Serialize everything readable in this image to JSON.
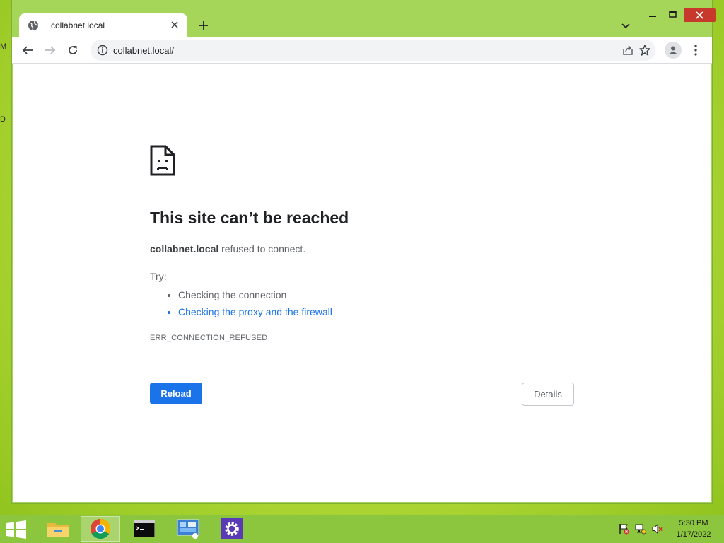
{
  "desktop": {
    "edge_marks": [
      "M",
      "D"
    ]
  },
  "browser": {
    "tab": {
      "title": "collabnet.local"
    },
    "address_bar": {
      "url": "collabnet.local/"
    }
  },
  "error_page": {
    "heading": "This site can’t be reached",
    "host": "collabnet.local",
    "summary_rest": " refused to connect.",
    "try_label": "Try:",
    "suggestions": [
      {
        "text": "Checking the connection",
        "is_link": false
      },
      {
        "text": "Checking the proxy and the firewall",
        "is_link": true
      }
    ],
    "error_code": "ERR_CONNECTION_REFUSED",
    "reload_label": "Reload",
    "details_label": "Details"
  },
  "taskbar": {
    "items": [
      "file-explorer",
      "chrome",
      "command-prompt",
      "control-panel",
      "settings"
    ],
    "clock": {
      "time": "5:30 PM",
      "date": "1/17/2022"
    }
  },
  "colors": {
    "accent": "#1a73e8",
    "window_frame": "#a5d65a",
    "close_button": "#c7392b"
  }
}
